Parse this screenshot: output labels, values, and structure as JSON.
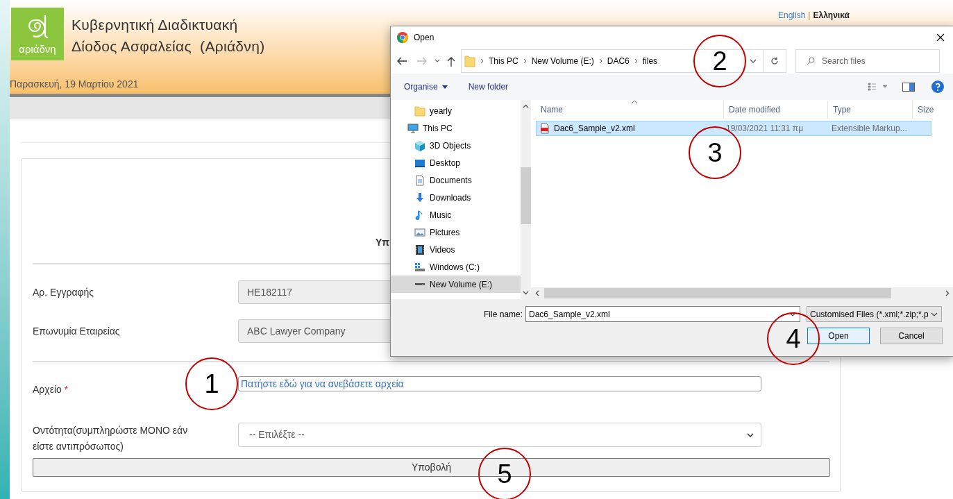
{
  "site": {
    "logo_text": "αριάδνη",
    "title_lines": [
      "Κυβερνητική Διαδικτυακή",
      "Δίοδος Ασφαλείας  (Αριάδνη)"
    ],
    "date": "Παρασκευή, 19 Μαρτίου 2021"
  },
  "languages": [
    {
      "label": "English",
      "selected": false
    },
    {
      "label": "Ελληνικά",
      "selected": true
    }
  ],
  "languages_separator": "|",
  "form": {
    "heading": "Υπ",
    "fields": [
      {
        "kind": "readonly",
        "label": "Αρ. Εγγραφής",
        "value": "HE182117"
      },
      {
        "kind": "readonly",
        "label": "Επωνυμία Εταιρείας",
        "value": "ABC Lawyer Company"
      },
      {
        "kind": "divider"
      },
      {
        "kind": "file",
        "label": "Αρχείο",
        "required": true,
        "value": "Πατήστε εδώ για να ανεβάσετε αρχεία"
      },
      {
        "kind": "select",
        "label": "Οντότητα(συμπληρώστε ΜΟΝΟ εάν είστε αντιπρόσωπος)",
        "value": "-- Επιλέξτε --"
      }
    ],
    "required_mark": "*",
    "submit": "Υποβολή"
  },
  "dialog": {
    "title": "Open",
    "breadcrumbs": [
      "This PC",
      "New Volume (E:)",
      "DAC6",
      "files"
    ],
    "search_placeholder": "Search files",
    "toolbar": [
      "Organise",
      "New folder"
    ],
    "nav": [
      {
        "label": "yearly",
        "kind": "folder",
        "selected": false
      },
      {
        "label": "This PC",
        "kind": "pc",
        "selected": false,
        "children": [
          {
            "label": "3D Objects",
            "kind": "cube",
            "selected": false
          },
          {
            "label": "Desktop",
            "kind": "desktop",
            "selected": false
          },
          {
            "label": "Documents",
            "kind": "document",
            "selected": false
          },
          {
            "label": "Downloads",
            "kind": "download",
            "selected": false
          },
          {
            "label": "Music",
            "kind": "music",
            "selected": false
          },
          {
            "label": "Pictures",
            "kind": "pictures",
            "selected": false
          },
          {
            "label": "Videos",
            "kind": "videos",
            "selected": false
          },
          {
            "label": "Windows (C:)",
            "kind": "system-drive",
            "selected": false
          },
          {
            "label": "New Volume (E:)",
            "kind": "drive",
            "selected": true
          }
        ]
      }
    ],
    "columns": [
      "Name",
      "Date modified",
      "Type",
      "Size"
    ],
    "files": [
      {
        "name": "Dac6_Sample_v2.xml",
        "date": "19/03/2021 11:31 πμ",
        "type": "Extensible Markup...",
        "selected": true
      }
    ],
    "file_name_label": "File name:",
    "file_name": "Dac6_Sample_v2.xml",
    "filter": "Customised Files (*.xml;*.zip;*.p",
    "buttons": [
      "Open",
      "Cancel"
    ]
  },
  "annotations": [
    {
      "label": "1"
    },
    {
      "label": "2"
    },
    {
      "label": "3"
    },
    {
      "label": "4"
    },
    {
      "label": "5"
    }
  ]
}
